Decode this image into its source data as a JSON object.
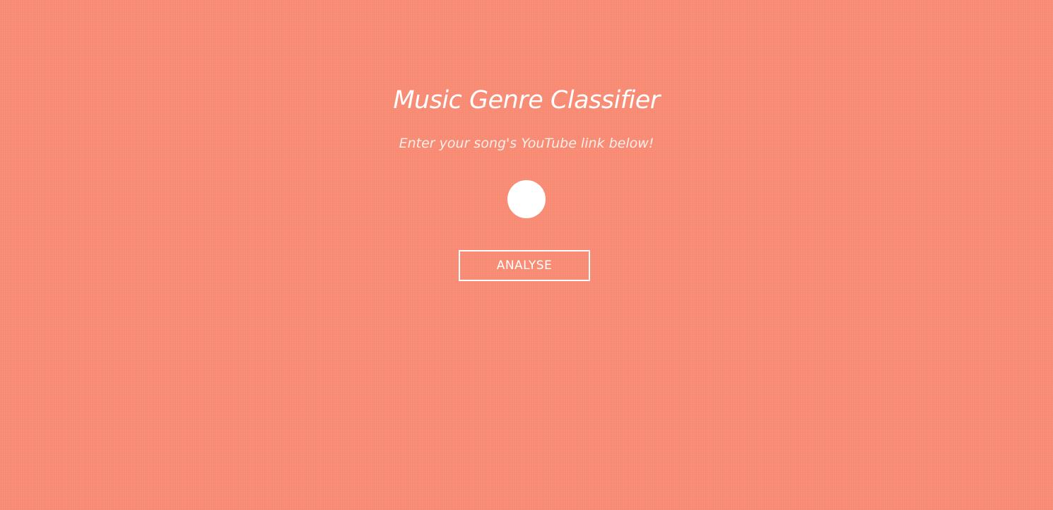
{
  "header": {
    "title": "Music Genre Classifier",
    "subtitle": "Enter your song's YouTube link below!"
  },
  "form": {
    "link_input_value": "",
    "analyse_label": "ANALYSE"
  },
  "colors": {
    "background": "#f88a72",
    "foreground": "#ffffff"
  }
}
